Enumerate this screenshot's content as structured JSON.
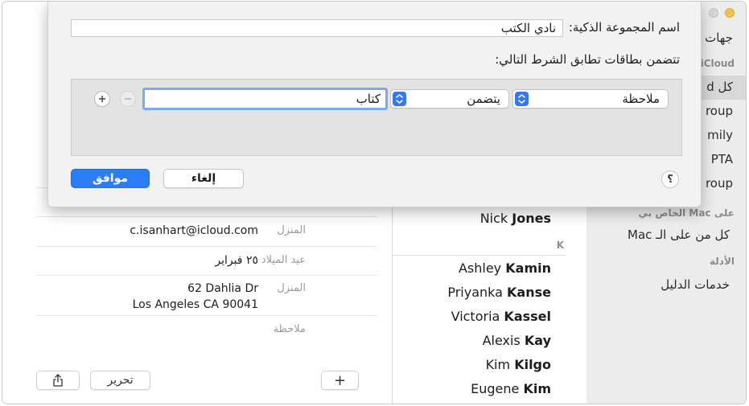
{
  "sidebar": {
    "items_top": [
      {
        "label": "جهات"
      },
      {
        "label": "iCloud"
      },
      {
        "label": "كل d"
      },
      {
        "label": "roup"
      },
      {
        "label": "mily"
      },
      {
        "label": "PTA"
      },
      {
        "label": "roup"
      }
    ],
    "mac_header": "على Mac الخاص بي",
    "mac_item": "كل من على الـ Mac",
    "directories_header": "الأدلة",
    "directory_services": "خدمات الدليل"
  },
  "contacts": {
    "section_letter": "K",
    "items": [
      {
        "first": "Nick",
        "last": "Jones"
      },
      {
        "first": "Ashley",
        "last": "Kamin"
      },
      {
        "first": "Priyanka",
        "last": "Kanse"
      },
      {
        "first": "Victoria",
        "last": "Kassel"
      },
      {
        "first": "Alexis",
        "last": "Kay"
      },
      {
        "first": "Kim",
        "last": "Kilgo"
      },
      {
        "first": "Eugene",
        "last": "Kim"
      }
    ]
  },
  "detail": {
    "email_label": "المنزل",
    "email_value": "c.isanhart@icloud.com",
    "birthday_label": "عيد الميلاد",
    "birthday_value": "٢٥ فبراير",
    "address_label": "المنزل",
    "address_line1": "62 Dahlia Dr",
    "address_line2": "Los Angeles CA 90041",
    "note_label": "ملاحظة",
    "edit_button": "تحرير",
    "add_button": "+"
  },
  "dialog": {
    "group_name_label": "اسم المجموعة الذكية:",
    "group_name_value": "نادي الكتب",
    "condition_label": "تتضمن بطاقات تطابق الشرط التالي:",
    "field_popup": "ملاحظة",
    "operator_popup": "يتضمن",
    "value_field": "كتاب",
    "cancel_button": "إلغاء",
    "ok_button": "موافق",
    "help_button": "؟"
  },
  "colors": {
    "accent": "#2b7cf5",
    "sidebar_bg": "#ececec",
    "sheet_bg": "#f2f2f2"
  }
}
